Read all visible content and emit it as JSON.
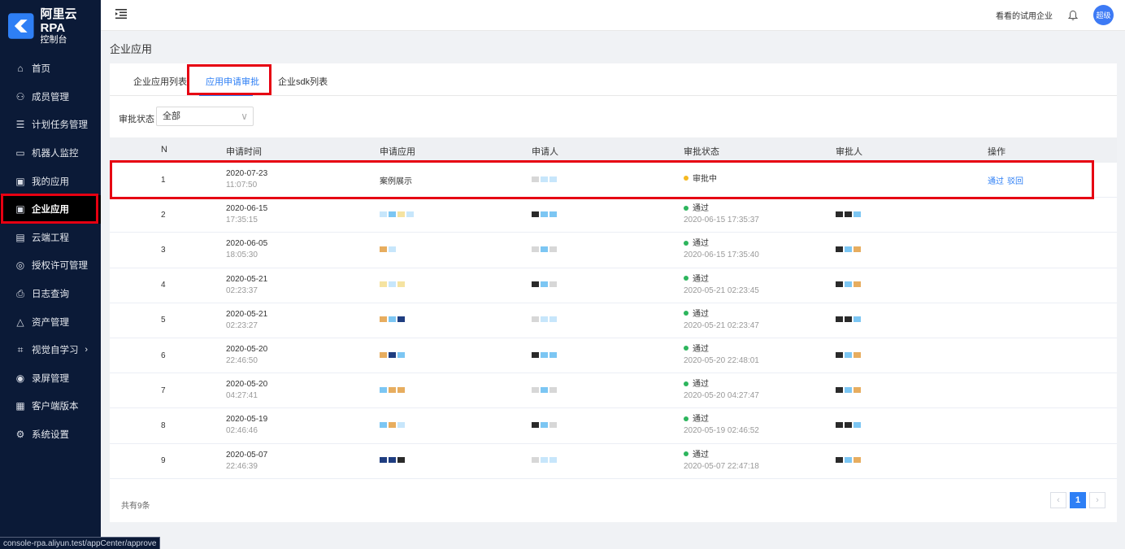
{
  "brand": {
    "title": "阿里云RPA",
    "subtitle": "控制台"
  },
  "sidebar": {
    "items": [
      {
        "label": "首页",
        "icon": "home-icon",
        "glyph": "⌂"
      },
      {
        "label": "成员管理",
        "icon": "users-icon",
        "glyph": "⚇"
      },
      {
        "label": "计划任务管理",
        "icon": "list-icon",
        "glyph": "☰"
      },
      {
        "label": "机器人监控",
        "icon": "monitor-icon",
        "glyph": "▭"
      },
      {
        "label": "我的应用",
        "icon": "app-icon",
        "glyph": "▣"
      },
      {
        "label": "企业应用",
        "icon": "enterprise-app-icon",
        "glyph": "▣",
        "active": true
      },
      {
        "label": "云端工程",
        "icon": "cloud-project-icon",
        "glyph": "▤"
      },
      {
        "label": "授权许可管理",
        "icon": "shield-icon",
        "glyph": "◎"
      },
      {
        "label": "日志查询",
        "icon": "log-icon",
        "glyph": "⎙"
      },
      {
        "label": "资产管理",
        "icon": "asset-icon",
        "glyph": "△"
      },
      {
        "label": "视觉自学习",
        "icon": "vision-icon",
        "glyph": "⌗",
        "arrow": "›"
      },
      {
        "label": "录屏管理",
        "icon": "record-icon",
        "glyph": "◉"
      },
      {
        "label": "客户端版本",
        "icon": "client-icon",
        "glyph": "▦"
      },
      {
        "label": "系统设置",
        "icon": "settings-icon",
        "glyph": "⚙"
      }
    ]
  },
  "status_url": "console-rpa.aliyun.test/appCenter/approve",
  "header": {
    "org_name": "看看的试用企业",
    "avatar_text": "超级"
  },
  "page": {
    "title": "企业应用"
  },
  "tabs": [
    "企业应用列表",
    "应用申请审批",
    "企业sdk列表"
  ],
  "filter": {
    "label": "审批状态",
    "value": "全部",
    "chevron": "∨"
  },
  "table": {
    "headers": {
      "n": "N",
      "time": "申请时间",
      "app": "申请应用",
      "user": "申请人",
      "status": "审批状态",
      "approver": "审批人",
      "op": "操作"
    },
    "rows": [
      {
        "n": "1",
        "date": "2020-07-23",
        "clock": "11:07:50",
        "app": "案例展示",
        "status": "审批中",
        "status_color": "#f5b921",
        "status_time": "",
        "ops": [
          "通过",
          "驳回"
        ]
      },
      {
        "n": "2",
        "date": "2020-06-15",
        "clock": "17:35:15",
        "app": "",
        "status": "通过",
        "status_color": "#2db55d",
        "status_time": "2020-06-15 17:35:37",
        "ops": []
      },
      {
        "n": "3",
        "date": "2020-06-05",
        "clock": "18:05:30",
        "app": "",
        "status": "通过",
        "status_color": "#2db55d",
        "status_time": "2020-06-15 17:35:40",
        "ops": []
      },
      {
        "n": "4",
        "date": "2020-05-21",
        "clock": "02:23:37",
        "app": "",
        "status": "通过",
        "status_color": "#2db55d",
        "status_time": "2020-05-21 02:23:45",
        "ops": []
      },
      {
        "n": "5",
        "date": "2020-05-21",
        "clock": "02:23:27",
        "app": "",
        "status": "通过",
        "status_color": "#2db55d",
        "status_time": "2020-05-21 02:23:47",
        "ops": []
      },
      {
        "n": "6",
        "date": "2020-05-20",
        "clock": "22:46:50",
        "app": "",
        "status": "通过",
        "status_color": "#2db55d",
        "status_time": "2020-05-20 22:48:01",
        "ops": []
      },
      {
        "n": "7",
        "date": "2020-05-20",
        "clock": "04:27:41",
        "app": "",
        "status": "通过",
        "status_color": "#2db55d",
        "status_time": "2020-05-20 04:27:47",
        "ops": []
      },
      {
        "n": "8",
        "date": "2020-05-19",
        "clock": "02:46:46",
        "app": "",
        "status": "通过",
        "status_color": "#2db55d",
        "status_time": "2020-05-19 02:46:52",
        "ops": []
      },
      {
        "n": "9",
        "date": "2020-05-07",
        "clock": "22:46:39",
        "app": "",
        "status": "通过",
        "status_color": "#2db55d",
        "status_time": "2020-05-07 22:47:18",
        "ops": []
      }
    ]
  },
  "footer": {
    "total": "共有9条",
    "current_page": "1",
    "prev": "‹",
    "next": "›"
  },
  "colors": {
    "sidebar_bg": "#0b1a37",
    "accent": "#2e7ff5",
    "highlight": "#e60012"
  }
}
